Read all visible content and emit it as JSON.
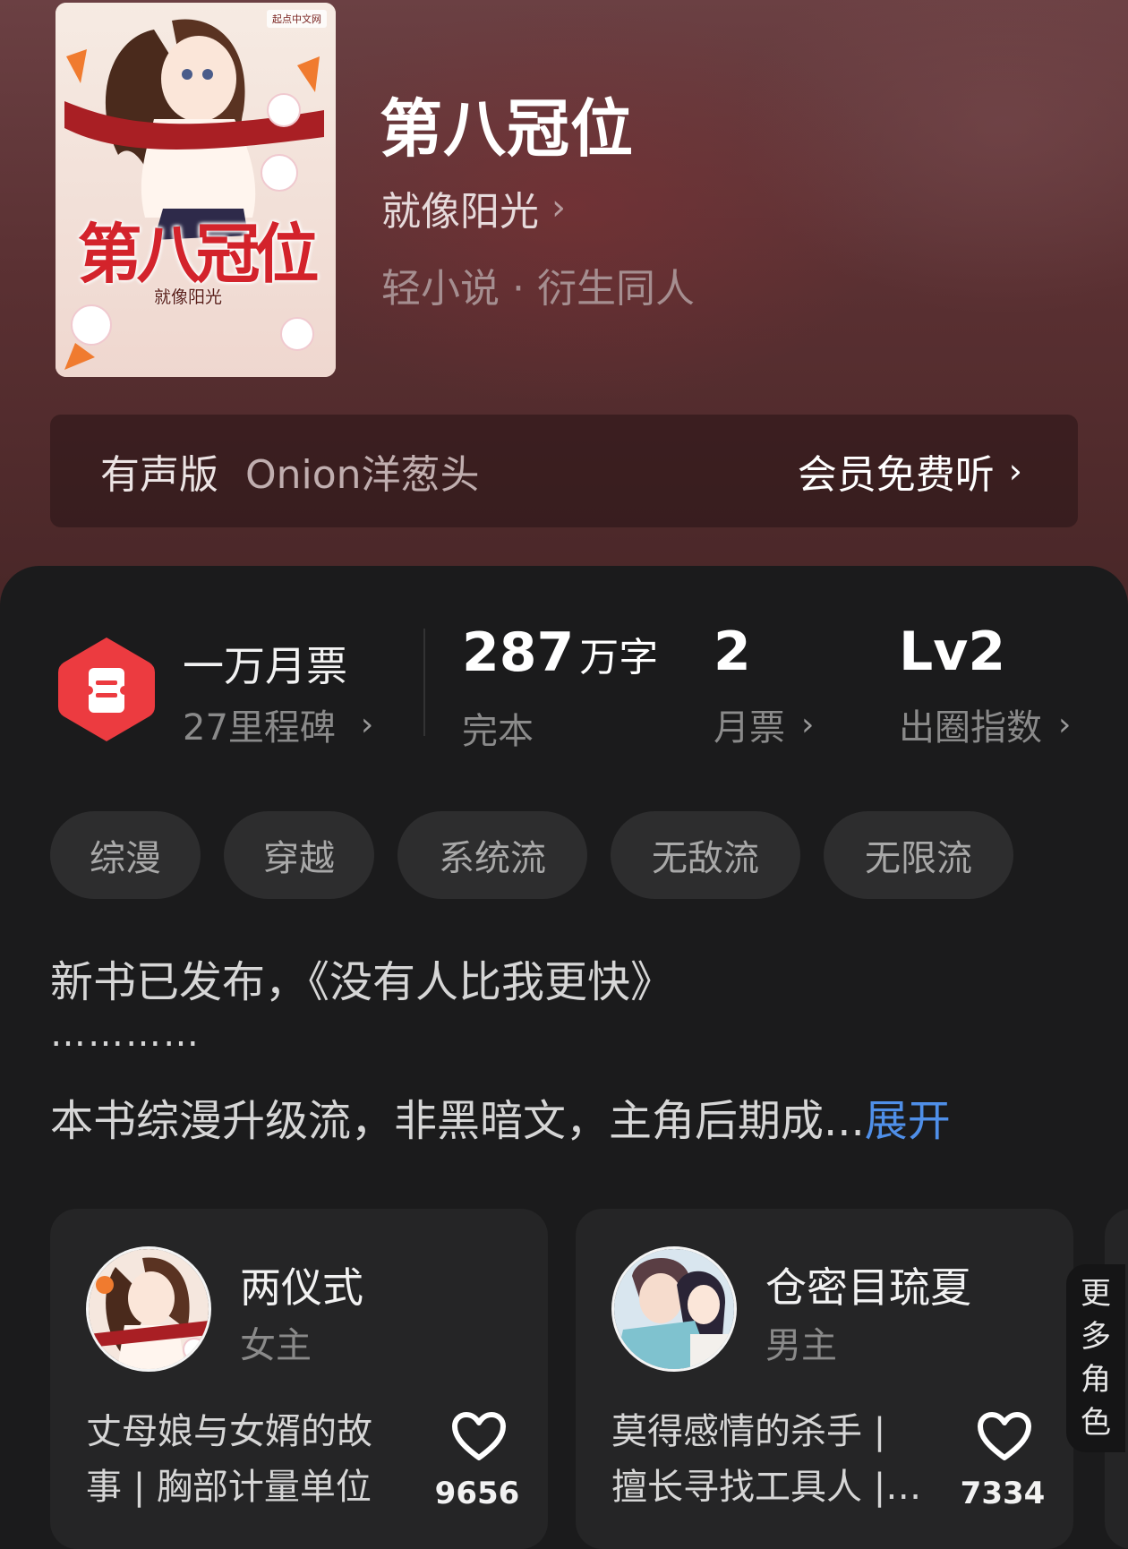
{
  "book": {
    "title": "第八冠位",
    "author": "就像阳光",
    "genre": "轻小说 · 衍生同人",
    "cover_title_art": "第八冠位",
    "cover_author_art": "就像阳光",
    "cover_logo": "起点中文网"
  },
  "audio": {
    "label": "有声版",
    "narrator": "Onion洋葱头",
    "cta": "会员免费听"
  },
  "stats": {
    "ticket_title": "一万月票",
    "ticket_sub": "27里程碑",
    "words_value": "287",
    "words_unit": "万字",
    "words_label": "完本",
    "monthly_value": "2",
    "monthly_label": "月票",
    "level_value": "Lv2",
    "level_label": "出圈指数"
  },
  "tags": [
    "综漫",
    "穿越",
    "系统流",
    "无敌流",
    "无限流"
  ],
  "description": {
    "line1": "新书已发布，《没有人比我更快》",
    "dots": "…………",
    "line2": "本书综漫升级流，非黑暗文，主角后期成...",
    "expand": "展开"
  },
  "characters": [
    {
      "name": "两仪式",
      "role": "女主",
      "desc": "丈母娘与女婿的故事 | 胸部计量单位",
      "likes": "9656"
    },
    {
      "name": "仓密目琉夏",
      "role": "男主",
      "desc": "莫得感情的杀手 | 擅长寻找工具人 |…",
      "likes": "7334"
    }
  ],
  "more_roles": "更多角色",
  "colors": {
    "accent_blue": "#4f8fe8",
    "badge_red": "#ec3b40",
    "background": "#1b1b1c"
  },
  "icons": [
    "chevron-right-icon",
    "ticket-icon",
    "heart-icon"
  ]
}
